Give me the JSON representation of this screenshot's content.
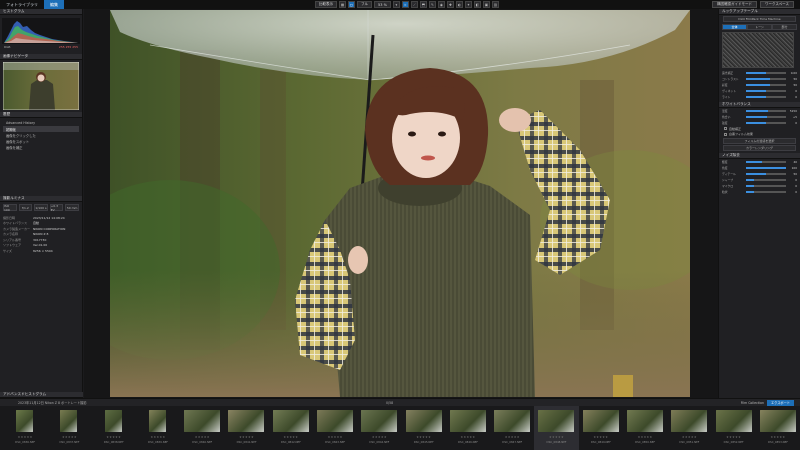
{
  "topbar": {
    "tabs": [
      "フォトライブラリ",
      "編集"
    ],
    "active_tab": 1,
    "center_buttons": [
      "比較表示",
      "フル"
    ],
    "zoom": "53 %",
    "right_buttons": [
      "構図確認ガイドモード",
      "ワークスペース"
    ]
  },
  "left": {
    "histogram_title": "ヒストグラム",
    "hist_left_label": "RGB",
    "hist_values": "255  255  255",
    "navigator_title": "画像ナビゲータ",
    "history_title": "履歴",
    "history_items": [
      "Advanced History",
      "初期化",
      "画像をクリックした",
      "画像をスポット",
      "画像を補正"
    ],
    "history_selected": 1,
    "meta_title": "撮影ルミナス",
    "meta_buttons": [
      "ISO 100",
      "f/1.2",
      "1/100 s",
      "+0.3 EV",
      "50 mm"
    ],
    "camera_rows": [
      {
        "k": "撮影日時",
        "v": "2023/11/12 14:08:24"
      },
      {
        "k": "ホワイトバランス",
        "v": "自動"
      },
      {
        "k": "カメラ製造メーカー",
        "v": "NIKON CORPORATION"
      },
      {
        "k": "カメラ名称",
        "v": "NIKON Z 8"
      },
      {
        "k": "シリアル番号",
        "v": "3017730"
      },
      {
        "k": "ソフトウェア",
        "v": "Ver.01.00"
      },
      {
        "k": "サイズ",
        "v": "8256 × 5504"
      }
    ],
    "footer_title": "アドバンスドヒストグラム"
  },
  "right": {
    "panel_title": "ルックアップテーブル",
    "lut_name": "DxO FilmPack Time Machine",
    "seg": [
      "全体",
      "トーン",
      "部分"
    ],
    "seg_active": 0,
    "sliders_a": [
      {
        "label": "露光補正",
        "value": "0.00",
        "pct": 50
      },
      {
        "label": "コントラスト",
        "value": "50",
        "pct": 60
      },
      {
        "label": "彩度",
        "value": "50",
        "pct": 60
      },
      {
        "label": "ヴィネット",
        "value": "0",
        "pct": 50
      },
      {
        "label": "ライト",
        "value": "0",
        "pct": 50
      }
    ],
    "section2_title": "ホワイトバランス",
    "sliders_b": [
      {
        "label": "温度",
        "value": "5150",
        "pct": 55
      },
      {
        "label": "色合い",
        "value": "+5",
        "pct": 52
      },
      {
        "label": "強度",
        "value": "0",
        "pct": 50
      }
    ],
    "checks": [
      "自動補正",
      "白黒フィルム効果"
    ],
    "buttons": [
      "フィルムの質感を選択",
      "カラーレンダリング"
    ],
    "section3_title": "ノイズ除去",
    "sliders_c": [
      {
        "label": "輝度",
        "value": "40",
        "pct": 40
      },
      {
        "label": "色度",
        "value": "100",
        "pct": 100
      },
      {
        "label": "ディテール",
        "value": "50",
        "pct": 50
      },
      {
        "label": "シャープ",
        "value": "0",
        "pct": 20
      },
      {
        "label": "マイクロ",
        "value": "0",
        "pct": 20
      },
      {
        "label": "粒状",
        "value": "0",
        "pct": 20
      }
    ]
  },
  "film": {
    "path": "2023年11月12日 Nikon Z 8 ポートレート撮影",
    "count": "0/58",
    "collection": "Film Collection",
    "export": "エクスポート",
    "thumbs": [
      {
        "name": "DSC_0836.NEF",
        "portrait": true
      },
      {
        "name": "DSC_0837.NEF",
        "portrait": true
      },
      {
        "name": "DSC_0838.NEF",
        "portrait": true
      },
      {
        "name": "DSC_0839.NEF",
        "portrait": true
      },
      {
        "name": "DSC_0840.NEF",
        "portrait": false
      },
      {
        "name": "DSC_0841.NEF",
        "portrait": false
      },
      {
        "name": "DSC_0842.NEF",
        "portrait": false
      },
      {
        "name": "DSC_0843.NEF",
        "portrait": false
      },
      {
        "name": "DSC_0844.NEF",
        "portrait": false
      },
      {
        "name": "DSC_0845.NEF",
        "portrait": false
      },
      {
        "name": "DSC_0846.NEF",
        "portrait": false
      },
      {
        "name": "DSC_0847.NEF",
        "portrait": false
      },
      {
        "name": "DSC_0848.NEF",
        "portrait": false
      },
      {
        "name": "DSC_0849.NEF",
        "portrait": false
      },
      {
        "name": "DSC_0850.NEF",
        "portrait": false
      },
      {
        "name": "DSC_0851.NEF",
        "portrait": false
      },
      {
        "name": "DSC_0852.NEF",
        "portrait": false
      },
      {
        "name": "DSC_0853.NEF",
        "portrait": false
      }
    ],
    "selected": 12
  }
}
